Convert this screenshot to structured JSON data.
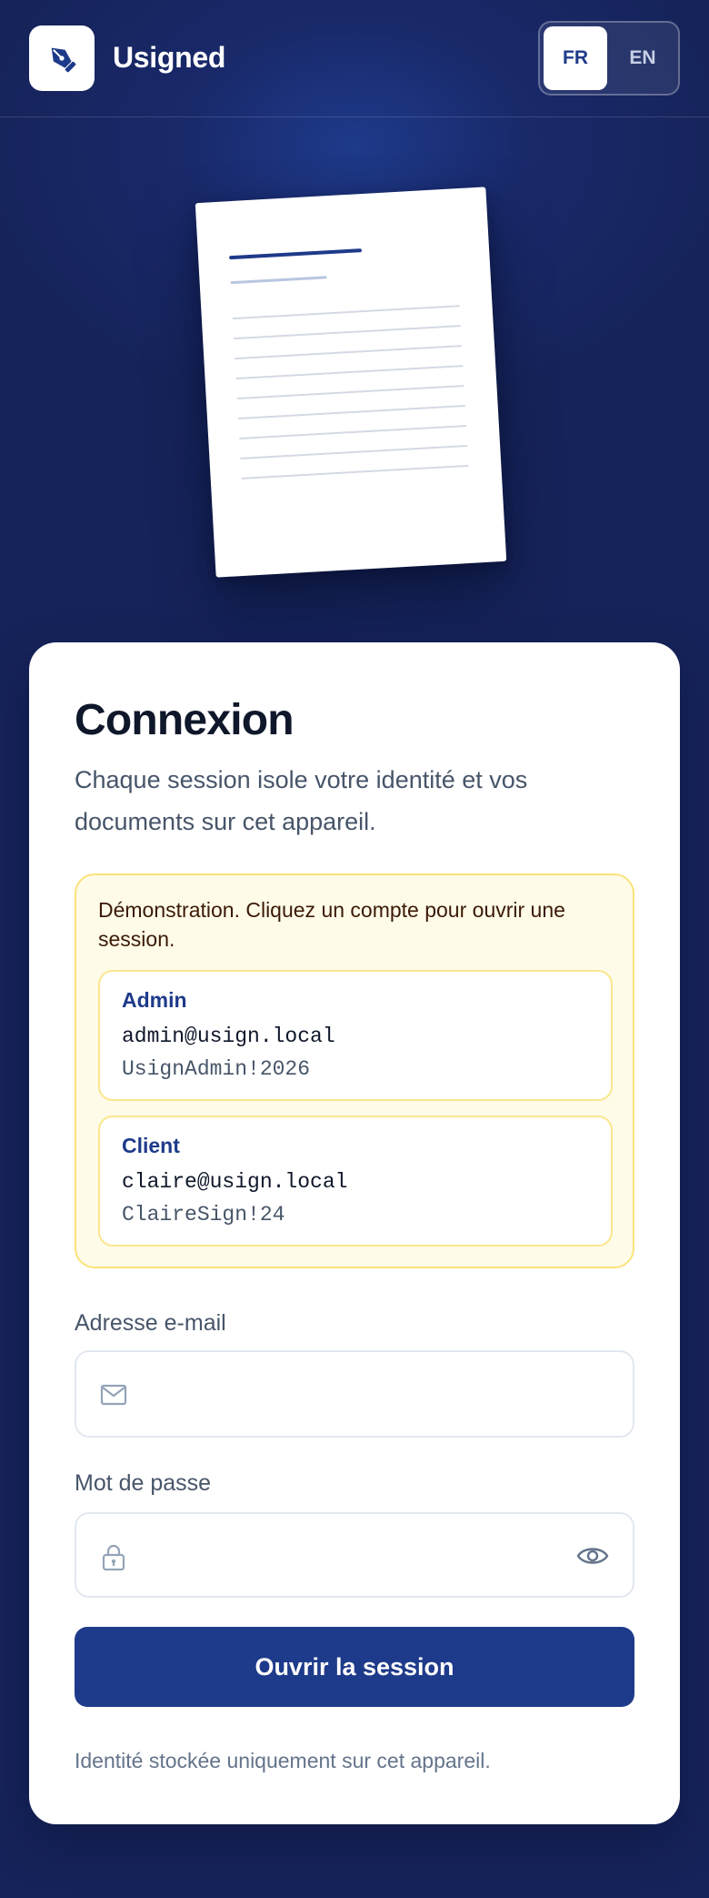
{
  "header": {
    "brand": "Usigned",
    "languages": [
      {
        "code": "FR",
        "active": true
      },
      {
        "code": "EN",
        "active": false
      }
    ]
  },
  "login": {
    "title": "Connexion",
    "subtitle": "Chaque session isole votre identité et vos documents sur cet appareil.",
    "demo": {
      "note": "Démonstration. Cliquez un compte pour ouvrir une session.",
      "accounts": [
        {
          "role": "Admin",
          "email": "admin@usign.local",
          "password": "UsignAdmin!2026"
        },
        {
          "role": "Client",
          "email": "claire@usign.local",
          "password": "ClaireSign!24"
        }
      ]
    },
    "email": {
      "label": "Adresse e-mail",
      "value": "",
      "placeholder": ""
    },
    "password": {
      "label": "Mot de passe",
      "value": "",
      "placeholder": ""
    },
    "submit_label": "Ouvrir la session",
    "footnote": "Identité stockée uniquement sur cet appareil."
  },
  "icons": {
    "logo": "pen-nib-icon",
    "email": "mail-icon",
    "password": "lock-icon",
    "reveal": "eye-icon"
  },
  "colors": {
    "background": "#172554",
    "primary": "#1e3a8a",
    "demo_bg": "#fefbe8",
    "demo_border": "#fbe27a"
  }
}
